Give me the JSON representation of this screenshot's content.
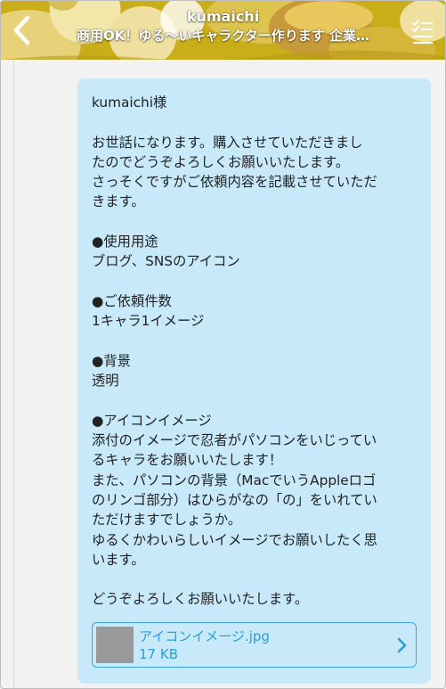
{
  "header": {
    "name": "kumaichi",
    "subtitle": "商用OK！ゆる〜いキャラクター作ります 企業…",
    "back_icon": "chevron-left-icon",
    "menu_icon": "checklist-menu-icon"
  },
  "message": {
    "lines": [
      "kumaichi様",
      "",
      "お世話になります。購入させていただきまし",
      "たのでどうぞよろしくお願いいたします。",
      "さっそくですがご依頼内容を記載させていただ",
      "きます。",
      "",
      "●使用用途",
      "ブログ、SNSのアイコン",
      "",
      "●ご依頼件数",
      "1キャラ1イメージ",
      "",
      "●背景",
      "透明",
      "",
      "●アイコンイメージ",
      "添付のイメージで忍者がパソコンをいじってい",
      "るキャラをお願いいたします！",
      "また、パソコンの背景（MacでいうAppleロゴ",
      "のリンゴ部分）はひらがなの「の」をいれてい",
      "ただけますでしょうか。",
      "ゆるくかわいらしいイメージでお願いしたく思",
      "います。",
      "",
      "どうぞよろしくお願いいたします。"
    ]
  },
  "attachment": {
    "filename": "アイコンイメージ.jpg",
    "size": "17 KB",
    "chevron_icon": "chevron-right-icon"
  },
  "colors": {
    "header_bg": "#c9ad19",
    "bubble_bg": "#c7e9fa",
    "link": "#2a9fd8",
    "page_bg": "#f2f2f2"
  }
}
